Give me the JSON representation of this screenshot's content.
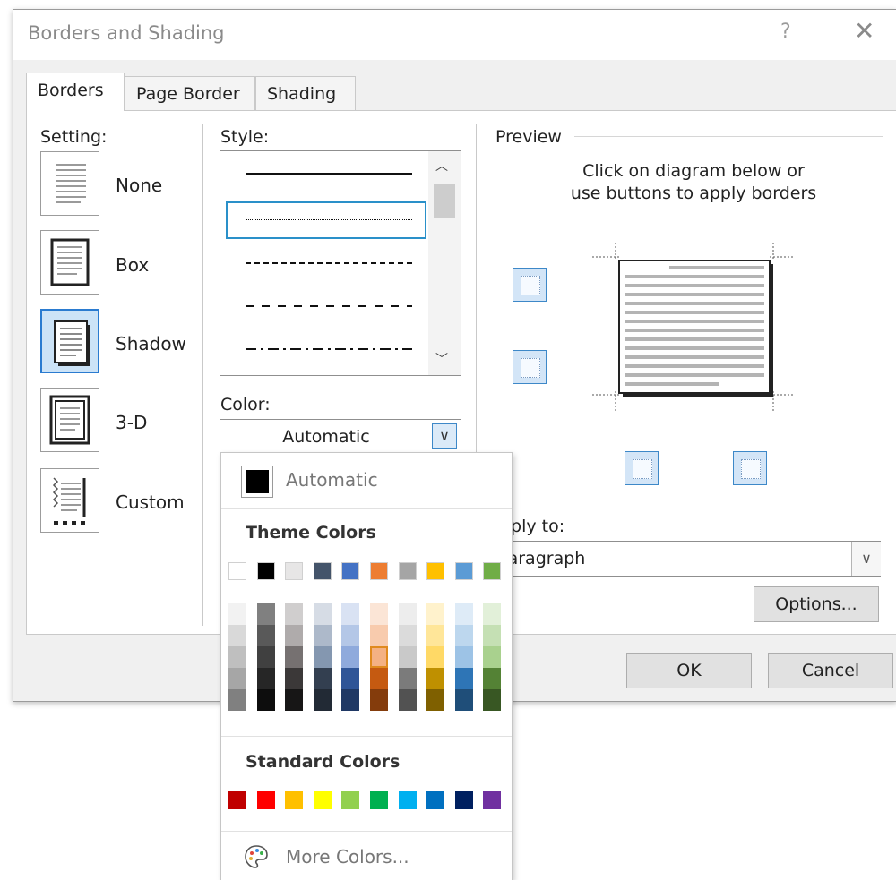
{
  "dialog": {
    "title": "Borders and Shading",
    "help": "?",
    "close": "✕",
    "tabs": [
      "Borders",
      "Page Border",
      "Shading"
    ]
  },
  "setting": {
    "label": "Setting:",
    "options": [
      "None",
      "Box",
      "Shadow",
      "3-D",
      "Custom"
    ],
    "selected": "Shadow"
  },
  "style": {
    "label": "Style:",
    "options": [
      "Solid",
      "Dotted",
      "Dashed small",
      "Dashed large",
      "Dash dot"
    ],
    "selected_index": 1
  },
  "color": {
    "label": "Color:",
    "value": "Automatic"
  },
  "preview": {
    "label": "Preview",
    "instructions_line1": "Click on diagram below or",
    "instructions_line2": "use buttons to apply borders"
  },
  "apply_to": {
    "label": "Apply to:",
    "value": "Paragraph"
  },
  "buttons": {
    "options": "Options...",
    "ok": "OK",
    "cancel": "Cancel"
  },
  "color_dropdown": {
    "automatic": "Automatic",
    "theme_header": "Theme Colors",
    "standard_header": "Standard Colors",
    "more_colors": "More Colors...",
    "theme_base": [
      "#ffffff",
      "#000000",
      "#e7e6e6",
      "#44546a",
      "#4472c4",
      "#ed7d31",
      "#a5a5a5",
      "#ffc000",
      "#5b9bd5",
      "#70ad47"
    ],
    "theme_shades": [
      [
        "#f2f2f2",
        "#d9d9d9",
        "#bfbfbf",
        "#a6a6a6",
        "#808080"
      ],
      [
        "#808080",
        "#595959",
        "#404040",
        "#262626",
        "#0d0d0d"
      ],
      [
        "#d0cece",
        "#afabab",
        "#767171",
        "#3b3838",
        "#171616"
      ],
      [
        "#d6dce5",
        "#adb9ca",
        "#8497b0",
        "#333f50",
        "#222a35"
      ],
      [
        "#d9e2f3",
        "#b4c7e7",
        "#8faadc",
        "#2f5597",
        "#1f3864"
      ],
      [
        "#fbe5d6",
        "#f8cbad",
        "#f4b183",
        "#c55a11",
        "#843c0c"
      ],
      [
        "#ededed",
        "#dbdbdb",
        "#c9c9c9",
        "#7b7b7b",
        "#525252"
      ],
      [
        "#fff2cc",
        "#ffe699",
        "#ffd966",
        "#bf9000",
        "#7f6000"
      ],
      [
        "#deebf7",
        "#bdd7ee",
        "#9dc3e6",
        "#2e75b6",
        "#1f4e79"
      ],
      [
        "#e2f0d9",
        "#c5e0b4",
        "#a9d18e",
        "#548235",
        "#385723"
      ]
    ],
    "highlighted": [
      5,
      2
    ],
    "standard": [
      "#c00000",
      "#ff0000",
      "#ffc000",
      "#ffff00",
      "#92d050",
      "#00b050",
      "#00b0f0",
      "#0070c0",
      "#002060",
      "#7030a0"
    ]
  }
}
